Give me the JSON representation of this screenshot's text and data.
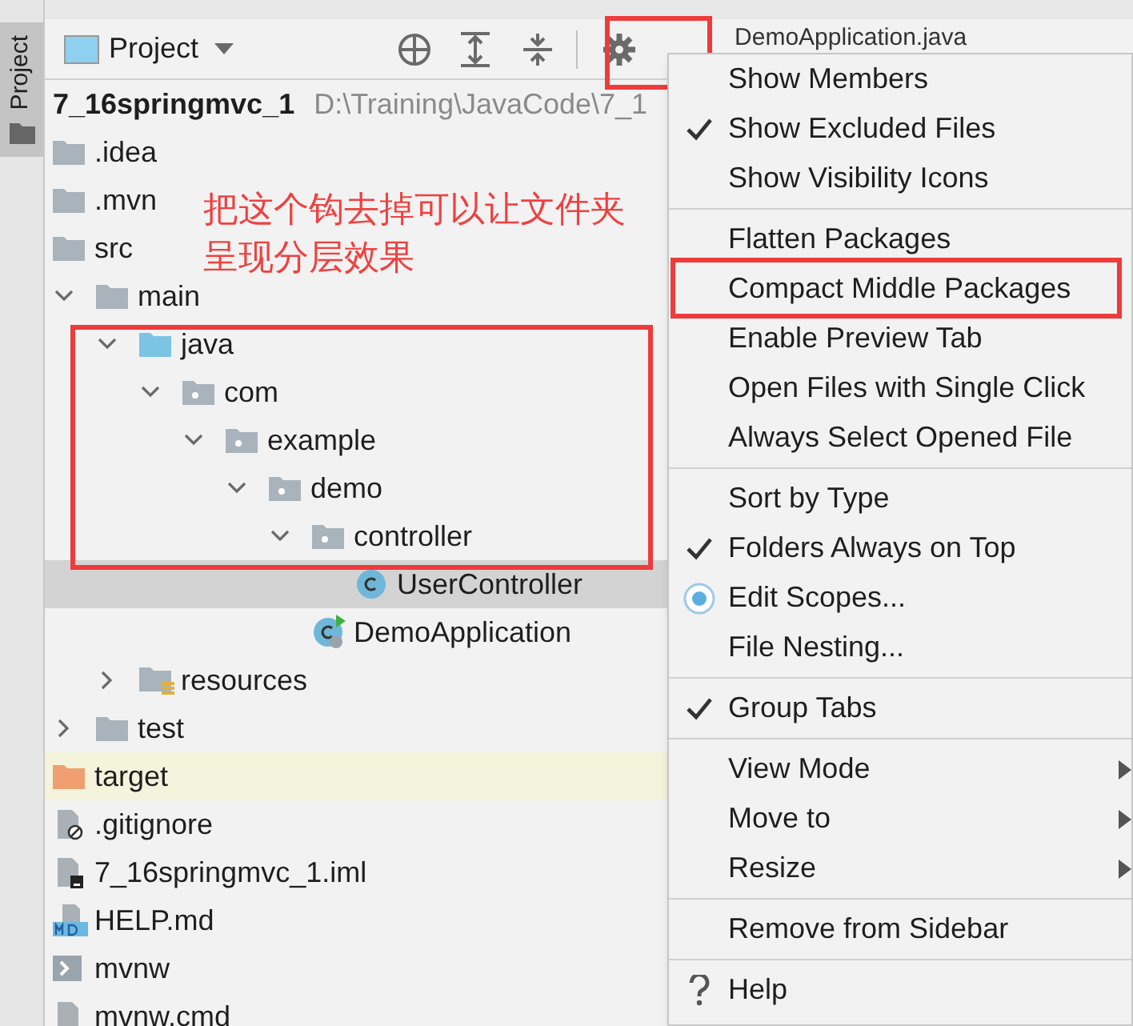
{
  "side_tab": {
    "label": "Project",
    "selected": true
  },
  "panel": {
    "title": "Project",
    "editor_tab": "DemoApplication.java"
  },
  "tree": {
    "root": {
      "name": "7_16springmvc_1",
      "path": "D:\\Training\\JavaCode\\7_1"
    },
    "items": [
      {
        "name": ".idea",
        "kind": "folder",
        "selected": false
      },
      {
        "name": ".mvn",
        "kind": "folder",
        "selected": false
      },
      {
        "name": "src",
        "kind": "folder",
        "selected": false,
        "children": [
          {
            "name": "main",
            "kind": "folder",
            "expanded": true,
            "selected": false,
            "children": [
              {
                "name": "java",
                "kind": "source-root",
                "expanded": true,
                "selected": false,
                "children": [
                  {
                    "name": "com",
                    "kind": "package",
                    "expanded": true,
                    "selected": false,
                    "children": [
                      {
                        "name": "example",
                        "kind": "package",
                        "expanded": true,
                        "selected": false,
                        "children": [
                          {
                            "name": "demo",
                            "kind": "package",
                            "expanded": true,
                            "selected": false,
                            "children": [
                              {
                                "name": "controller",
                                "kind": "package",
                                "expanded": true,
                                "selected": false,
                                "children": [
                                  {
                                    "name": "UserController",
                                    "kind": "class",
                                    "selected": true
                                  }
                                ]
                              },
                              {
                                "name": "DemoApplication",
                                "kind": "app-class",
                                "selected": false
                              }
                            ]
                          }
                        ]
                      }
                    ]
                  }
                ]
              },
              {
                "name": "resources",
                "kind": "resources",
                "expanded": false,
                "selected": false
              }
            ]
          },
          {
            "name": "test",
            "kind": "folder",
            "expanded": false,
            "selected": false
          }
        ]
      },
      {
        "name": "target",
        "kind": "excluded",
        "selected": false
      },
      {
        "name": ".gitignore",
        "kind": "ignore-file",
        "selected": false
      },
      {
        "name": "7_16springmvc_1.iml",
        "kind": "iml-file",
        "selected": false
      },
      {
        "name": "HELP.md",
        "kind": "md-file",
        "selected": false
      },
      {
        "name": "mvnw",
        "kind": "script-file",
        "selected": false
      },
      {
        "name": "mvnw.cmd",
        "kind": "cmd-file",
        "selected": false
      }
    ]
  },
  "annotation": {
    "lines": [
      "把这个钩去掉可以让文件夹",
      "呈现分层效果"
    ]
  },
  "menu": [
    {
      "kind": "toggle",
      "label": "Show Members",
      "checked": false
    },
    {
      "kind": "toggle",
      "label": "Show Excluded Files",
      "checked": true
    },
    {
      "kind": "toggle",
      "label": "Show Visibility Icons",
      "checked": false
    },
    {
      "kind": "separator"
    },
    {
      "kind": "toggle",
      "label": "Flatten Packages",
      "checked": false
    },
    {
      "kind": "toggle",
      "label": "Compact Middle Packages",
      "checked": false
    },
    {
      "kind": "toggle",
      "label": "Enable Preview Tab",
      "checked": false
    },
    {
      "kind": "toggle",
      "label": "Open Files with Single Click",
      "checked": false
    },
    {
      "kind": "toggle",
      "label": "Always Select Opened File",
      "checked": false
    },
    {
      "kind": "separator"
    },
    {
      "kind": "toggle",
      "label": "Sort by Type",
      "checked": false
    },
    {
      "kind": "toggle",
      "label": "Folders Always on Top",
      "checked": true
    },
    {
      "kind": "scopes",
      "label": "Edit Scopes..."
    },
    {
      "kind": "toggle",
      "label": "File Nesting...",
      "checked": false
    },
    {
      "kind": "separator"
    },
    {
      "kind": "toggle",
      "label": "Group Tabs",
      "checked": true
    },
    {
      "kind": "separator"
    },
    {
      "kind": "submenu",
      "label": "View Mode"
    },
    {
      "kind": "submenu",
      "label": "Move to"
    },
    {
      "kind": "submenu",
      "label": "Resize"
    },
    {
      "kind": "separator"
    },
    {
      "kind": "toggle",
      "label": "Remove from Sidebar",
      "checked": false
    },
    {
      "kind": "separator"
    },
    {
      "kind": "help",
      "label": "Help"
    }
  ]
}
